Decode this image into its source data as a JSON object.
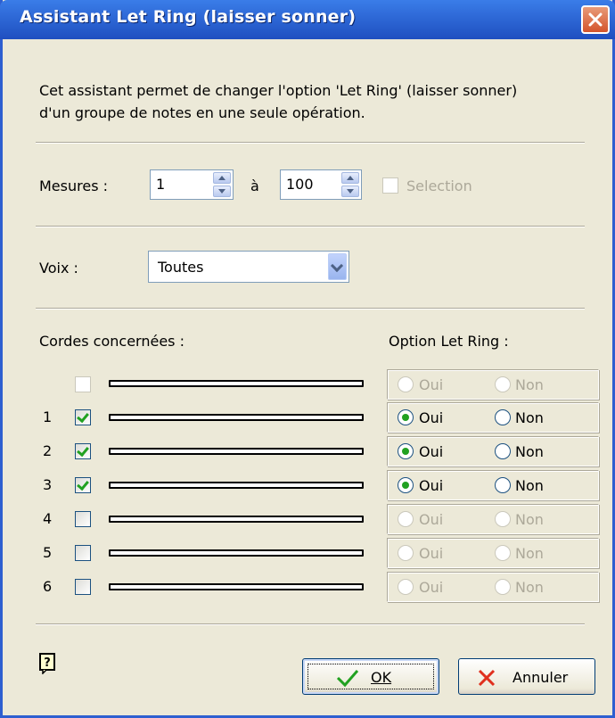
{
  "window": {
    "title": "Assistant Let Ring (laisser sonner)"
  },
  "description": {
    "line1": "Cet assistant permet de changer l'option 'Let Ring' (laisser sonner)",
    "line2": "d'un groupe de notes en une seule opération."
  },
  "measures": {
    "label": "Mesures :",
    "from_value": "1",
    "to_label": "à",
    "to_value": "100",
    "selection_label": "Selection",
    "selection_checked": false,
    "selection_enabled": false
  },
  "voice": {
    "label": "Voix :",
    "selected": "Toutes"
  },
  "strings_section": {
    "strings_label": "Cordes concernées :",
    "option_label": "Option Let Ring :",
    "yes_label": "Oui",
    "no_label": "Non",
    "rows": [
      {
        "number": "",
        "checked": false,
        "enabled": true,
        "option": "none",
        "option_enabled": false
      },
      {
        "number": "1",
        "checked": true,
        "enabled": true,
        "option": "yes",
        "option_enabled": true
      },
      {
        "number": "2",
        "checked": true,
        "enabled": true,
        "option": "yes",
        "option_enabled": true
      },
      {
        "number": "3",
        "checked": true,
        "enabled": true,
        "option": "yes",
        "option_enabled": true
      },
      {
        "number": "4",
        "checked": false,
        "enabled": true,
        "option": "none",
        "option_enabled": false
      },
      {
        "number": "5",
        "checked": false,
        "enabled": true,
        "option": "none",
        "option_enabled": false
      },
      {
        "number": "6",
        "checked": false,
        "enabled": true,
        "option": "none",
        "option_enabled": false
      }
    ]
  },
  "buttons": {
    "ok_label": "OK",
    "cancel_label": "Annuler"
  },
  "icons": {
    "close": "close-icon",
    "help": "help-icon",
    "ok": "checkmark-icon",
    "cancel": "cross-icon"
  },
  "colors": {
    "titlebar": "#2f6ad8",
    "dialog_bg": "#ece9d8",
    "check_green": "#21a121",
    "cancel_red": "#e0301e"
  }
}
